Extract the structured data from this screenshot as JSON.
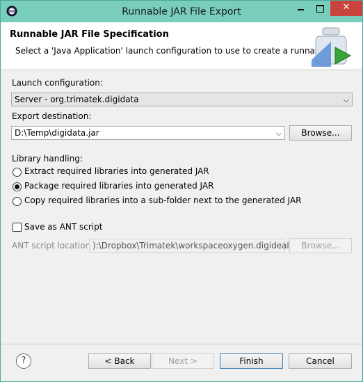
{
  "window": {
    "title": "Runnable JAR File Export"
  },
  "header": {
    "title": "Runnable JAR File Specification",
    "description": "Select a 'Java Application' launch configuration to use to create a runnable JAR."
  },
  "launch": {
    "label": "Launch configuration:",
    "value": "Server - org.trimatek.digidata"
  },
  "export": {
    "label": "Export destination:",
    "value": "D:\\Temp\\digidata.jar",
    "browse": "Browse..."
  },
  "library": {
    "label": "Library handling:",
    "options": [
      "Extract required libraries into generated JAR",
      "Package required libraries into generated JAR",
      "Copy required libraries into a sub-folder next to the generated JAR"
    ],
    "selected": 1
  },
  "ant": {
    "checkbox_label": "Save as ANT script",
    "location_label": "ANT script location:",
    "location_value": "):\\Dropbox\\Trimatek\\workspaceoxygen.digideal",
    "browse": "Browse..."
  },
  "footer": {
    "back": "< Back",
    "next": "Next >",
    "finish": "Finish",
    "cancel": "Cancel",
    "help": "?"
  }
}
